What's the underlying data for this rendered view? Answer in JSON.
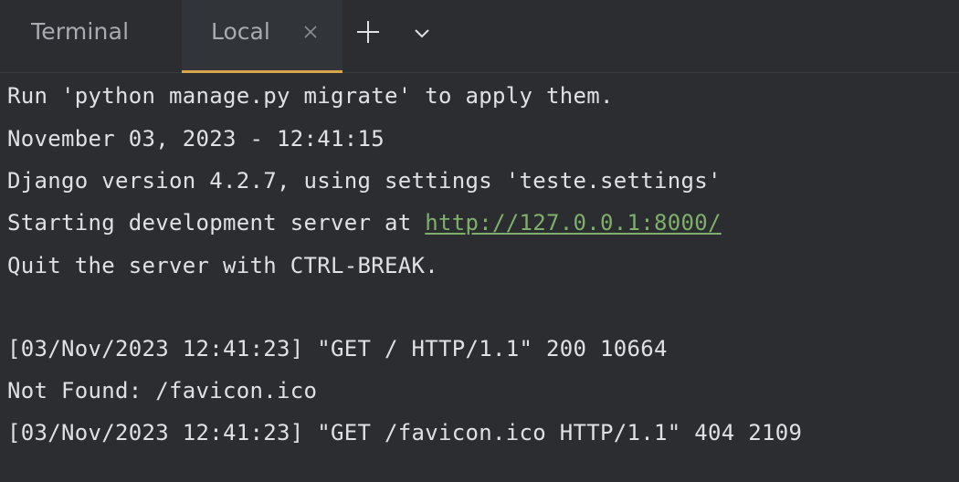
{
  "tabbar": {
    "tool_title": "Terminal",
    "tabs": [
      {
        "label": "Local",
        "active": true
      }
    ],
    "close_icon": "close-icon",
    "add_icon": "plus-icon",
    "menu_icon": "chevron-down-icon"
  },
  "terminal": {
    "lines": [
      "Run 'python manage.py migrate' to apply them.",
      "November 03, 2023 - 12:41:15",
      "Django version 4.2.7, using settings 'teste.settings'",
      "Starting development server at ",
      "Quit the server with CTRL-BREAK.",
      "",
      "[03/Nov/2023 12:41:23] \"GET / HTTP/1.1\" 200 10664",
      "Not Found: /favicon.ico",
      "[03/Nov/2023 12:41:23] \"GET /favicon.ico HTTP/1.1\" 404 2109"
    ],
    "server_link": "http://127.0.0.1:8000/"
  },
  "colors": {
    "background": "#2b2d30",
    "text": "#dfe1e5",
    "link": "#7fb06b",
    "active_tab_underline": "#d6a64a"
  }
}
